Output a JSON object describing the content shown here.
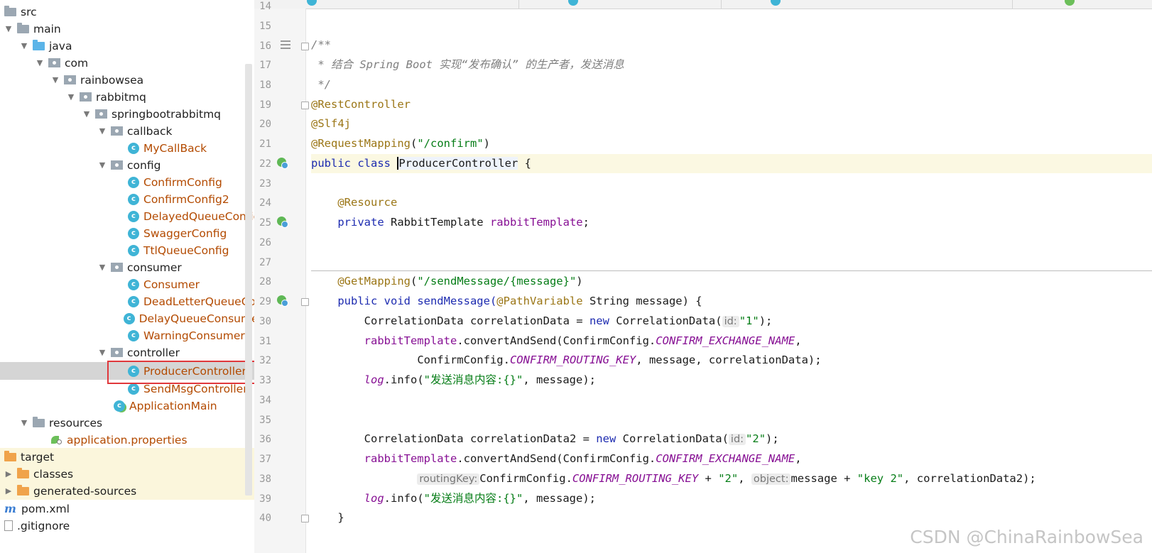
{
  "tree": {
    "items": [
      {
        "label": "src",
        "arrow": "",
        "icon": "folder"
      },
      {
        "label": "main",
        "arrow": "▼",
        "icon": "folder"
      },
      {
        "label": "java",
        "arrow": "▼",
        "icon": "folder-blue"
      },
      {
        "label": "com",
        "arrow": "▼",
        "icon": "package"
      },
      {
        "label": "rainbowsea",
        "arrow": "▼",
        "icon": "package"
      },
      {
        "label": "rabbitmq",
        "arrow": "▼",
        "icon": "package"
      },
      {
        "label": "springbootrabbitmq",
        "arrow": "▼",
        "icon": "package"
      },
      {
        "label": "callback",
        "arrow": "▼",
        "icon": "package"
      },
      {
        "label": "MyCallBack",
        "arrow": "",
        "icon": "class"
      },
      {
        "label": "config",
        "arrow": "▼",
        "icon": "package"
      },
      {
        "label": "ConfirmConfig",
        "arrow": "",
        "icon": "class"
      },
      {
        "label": "ConfirmConfig2",
        "arrow": "",
        "icon": "class"
      },
      {
        "label": "DelayedQueueConfig",
        "arrow": "",
        "icon": "class"
      },
      {
        "label": "SwaggerConfig",
        "arrow": "",
        "icon": "class"
      },
      {
        "label": "TtlQueueConfig",
        "arrow": "",
        "icon": "class"
      },
      {
        "label": "consumer",
        "arrow": "▼",
        "icon": "package"
      },
      {
        "label": "Consumer",
        "arrow": "",
        "icon": "class"
      },
      {
        "label": "DeadLetterQueueCon",
        "arrow": "",
        "icon": "class"
      },
      {
        "label": "DelayQueueConsumer",
        "arrow": "",
        "icon": "class"
      },
      {
        "label": "WarningConsumer",
        "arrow": "",
        "icon": "class"
      },
      {
        "label": "controller",
        "arrow": "▼",
        "icon": "package"
      },
      {
        "label": "ProducerController",
        "arrow": "",
        "icon": "class"
      },
      {
        "label": "SendMsgController",
        "arrow": "",
        "icon": "class"
      },
      {
        "label": "ApplicationMain",
        "arrow": "",
        "icon": "spring-class"
      },
      {
        "label": "resources",
        "arrow": "▼",
        "icon": "folder-res"
      },
      {
        "label": "application.properties",
        "arrow": "",
        "icon": "properties"
      },
      {
        "label": "target",
        "arrow": "",
        "icon": "folder-orange"
      },
      {
        "label": "classes",
        "arrow": "▶",
        "icon": "folder-orange"
      },
      {
        "label": "generated-sources",
        "arrow": "▶",
        "icon": "folder-orange"
      },
      {
        "label": "pom.xml",
        "arrow": "",
        "icon": "maven"
      },
      {
        "label": ".gitignore",
        "arrow": "",
        "icon": "file"
      }
    ]
  },
  "editor": {
    "lines": [
      {
        "n": "14"
      },
      {
        "n": "15"
      },
      {
        "n": "16"
      },
      {
        "n": "17"
      },
      {
        "n": "18"
      },
      {
        "n": "19"
      },
      {
        "n": "20"
      },
      {
        "n": "21"
      },
      {
        "n": "22"
      },
      {
        "n": "23"
      },
      {
        "n": "24"
      },
      {
        "n": "25"
      },
      {
        "n": "26"
      },
      {
        "n": "27"
      },
      {
        "n": "28"
      },
      {
        "n": "29"
      },
      {
        "n": "30"
      },
      {
        "n": "31"
      },
      {
        "n": "32"
      },
      {
        "n": "33"
      },
      {
        "n": "34"
      },
      {
        "n": "35"
      },
      {
        "n": "36"
      },
      {
        "n": "37"
      },
      {
        "n": "38"
      },
      {
        "n": "39"
      },
      {
        "n": "40"
      }
    ],
    "code": {
      "l16": "/**",
      "l17": " * 结合 Spring Boot 实现“发布确认” 的生产者，发送消息",
      "l18": " */",
      "l19": "@RestController",
      "l20": "@Slf4j",
      "l21_ann": "@RequestMapping",
      "l21_p1": "(",
      "l21_str": "\"/confirm\"",
      "l21_p2": ")",
      "l22_kw": "public class ",
      "l22_name": "ProducerController",
      "l22_tail": " {",
      "l24": "@Resource",
      "l25_kw": "private ",
      "l25_type": "RabbitTemplate ",
      "l25_fld": "rabbitTemplate",
      "l25_tail": ";",
      "l28_ann": "@GetMapping",
      "l28_p1": "(",
      "l28_str": "\"/sendMessage/{message}\"",
      "l28_p2": ")",
      "l29_kw": "public void ",
      "l29_name": "sendMessage(",
      "l29_ann": "@PathVariable",
      "l29_tail": " String message) {",
      "l30_a": "CorrelationData correlationData = ",
      "l30_kw": "new ",
      "l30_b": "CorrelationData(",
      "l30_hint": "id:",
      "l30_str": "\"1\"",
      "l30_tail": ");",
      "l31_fld": "rabbitTemplate",
      "l31_a": ".convertAndSend(ConfirmConfig.",
      "l31_cst": "CONFIRM_EXCHANGE_NAME",
      "l31_tail": ",",
      "l32_a": "ConfirmConfig.",
      "l32_cst": "CONFIRM_ROUTING_KEY",
      "l32_tail": ", message, correlationData);",
      "l33_log": "log",
      "l33_a": ".info(",
      "l33_str": "\"发送消息内容:{}\"",
      "l33_tail": ", message);",
      "l36_a": "CorrelationData correlationData2 = ",
      "l36_kw": "new ",
      "l36_b": "CorrelationData(",
      "l36_hint": "id:",
      "l36_str": "\"2\"",
      "l36_tail": ");",
      "l37_fld": "rabbitTemplate",
      "l37_a": ".convertAndSend(ConfirmConfig.",
      "l37_cst": "CONFIRM_EXCHANGE_NAME",
      "l37_tail": ",",
      "l38_hint1": "routingKey:",
      "l38_a": "ConfirmConfig.",
      "l38_cst": "CONFIRM_ROUTING_KEY",
      "l38_b": " + ",
      "l38_str1": "\"2\"",
      "l38_c": ", ",
      "l38_hint2": "object:",
      "l38_d": "message + ",
      "l38_str2": "\"key 2\"",
      "l38_tail": ", correlationData2);",
      "l39_log": "log",
      "l39_a": ".info(",
      "l39_str": "\"发送消息内容:{}\"",
      "l39_tail": ", message);",
      "l40": "}"
    }
  },
  "watermark": "CSDN @ChinaRainbowSea",
  "colors": {
    "keyword": "#1d2bb0",
    "annotation": "#9b7616",
    "string": "#067d17",
    "field": "#871094",
    "highlight_border": "#e0383c"
  }
}
